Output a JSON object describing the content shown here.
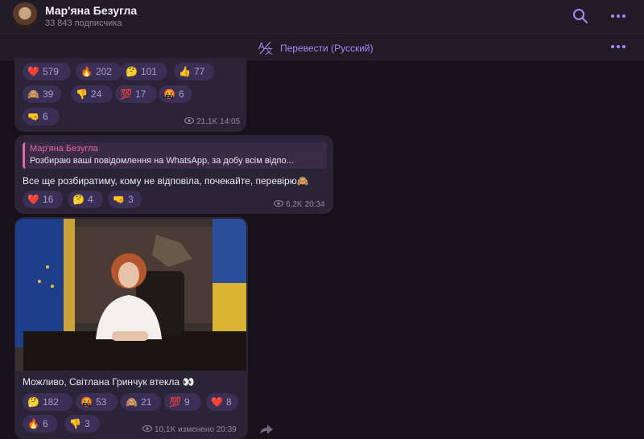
{
  "header": {
    "channel_name": "Мар'яна Безугла",
    "subscribers": "33 843 подписчика"
  },
  "translate": {
    "label": "Перевести (Русский)"
  },
  "colors": {
    "accent": "#a78bfa",
    "reply_name": "#e36aa4",
    "bubble": "#2a2437",
    "reaction": "#3a2f55"
  },
  "post1": {
    "reactions": [
      {
        "emoji": "❤️",
        "count": "579"
      },
      {
        "emoji": "🔥",
        "count": "202"
      },
      {
        "emoji": "🤔",
        "count": "101"
      },
      {
        "emoji": "👍",
        "count": "77"
      },
      {
        "emoji": "🙈",
        "count": "39"
      },
      {
        "emoji": "👎",
        "count": "24"
      },
      {
        "emoji": "💯",
        "count": "17"
      },
      {
        "emoji": "🤬",
        "count": "6"
      },
      {
        "emoji": "🤜",
        "count": "6"
      }
    ],
    "views": "21,1K",
    "time": "14:05"
  },
  "post2": {
    "reply_name": "Мар'яна Безугла",
    "reply_text": "Розбираю ваші повідомлення на WhatsApp, за добу всім відпо...",
    "text": "Все ще розбиратиму, кому не відповіла, почекайте, перевірю🙈",
    "reactions": [
      {
        "emoji": "❤️",
        "count": "16"
      },
      {
        "emoji": "🤔",
        "count": "4"
      },
      {
        "emoji": "🤜",
        "count": "3"
      }
    ],
    "views": "6,2K",
    "time": "20:34"
  },
  "post3": {
    "text": "Можливо, Світлана Гринчук втекла 👀",
    "reactions": [
      {
        "emoji": "🤔",
        "count": "182"
      },
      {
        "emoji": "🤬",
        "count": "53"
      },
      {
        "emoji": "🙈",
        "count": "21"
      },
      {
        "emoji": "💯",
        "count": "9"
      },
      {
        "emoji": "❤️",
        "count": "8"
      },
      {
        "emoji": "🔥",
        "count": "6"
      },
      {
        "emoji": "👎",
        "count": "3"
      }
    ],
    "views": "10,1K",
    "time_label": "изменено 20:39"
  }
}
